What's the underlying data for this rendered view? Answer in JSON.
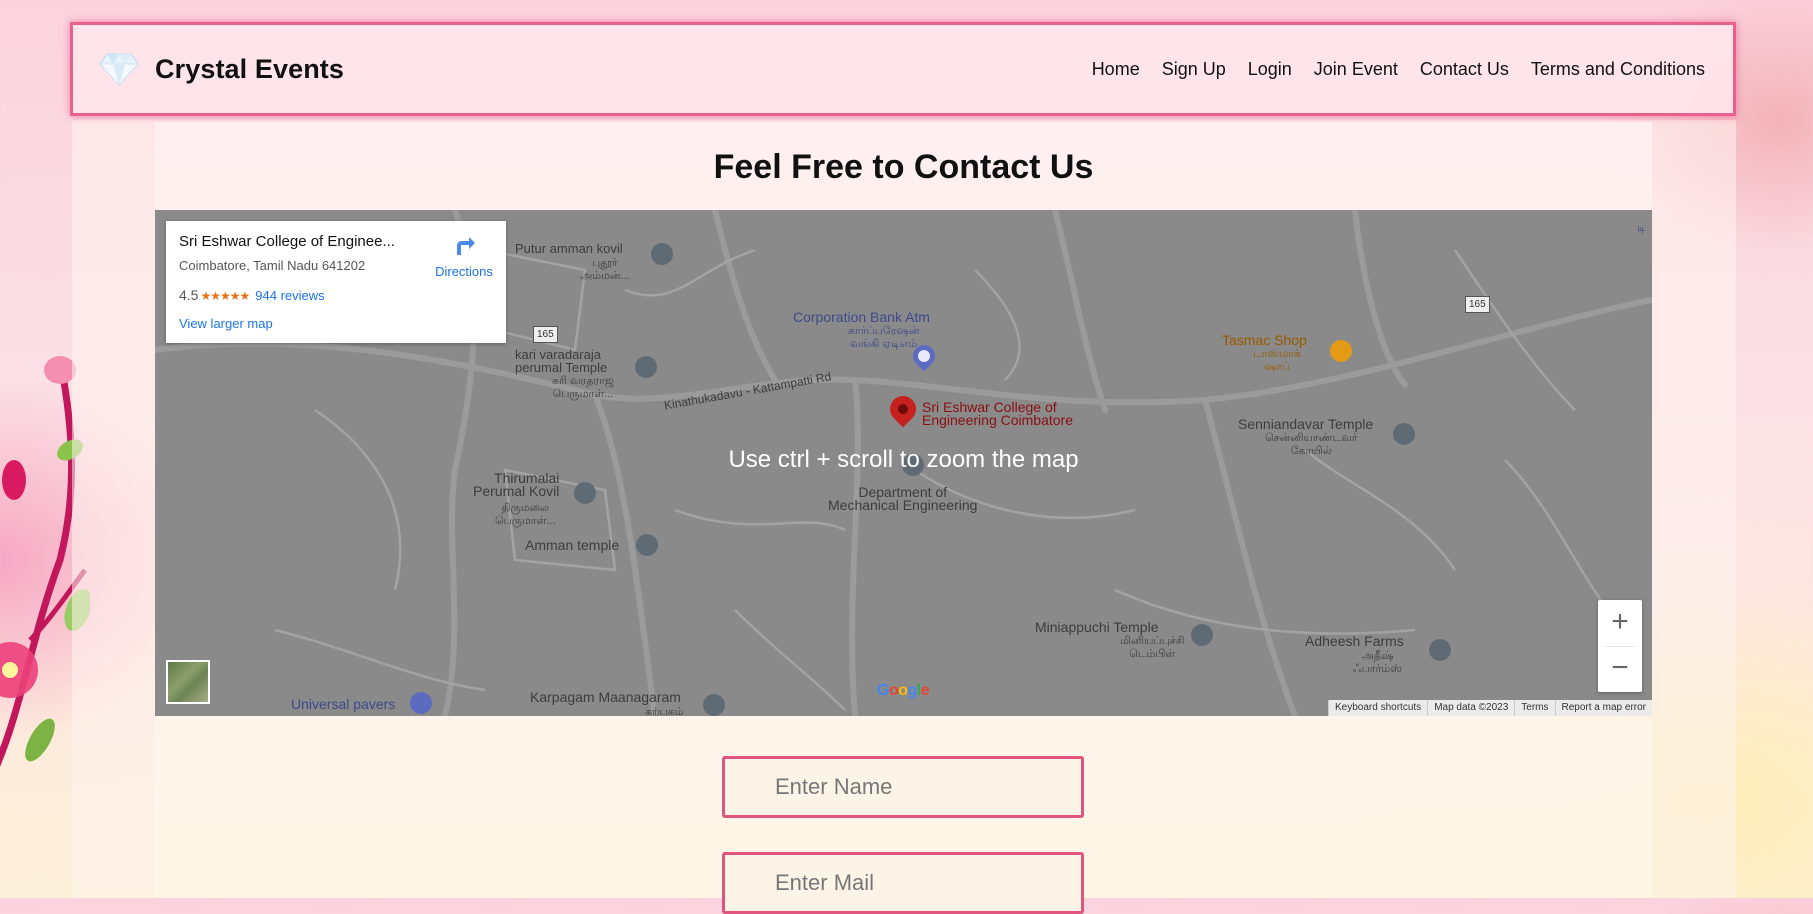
{
  "brand": {
    "name": "Crystal Events",
    "logo_icon": "diamond-icon"
  },
  "nav": {
    "links": [
      "Home",
      "Sign Up",
      "Login",
      "Join Event",
      "Contact Us",
      "Terms and Conditions"
    ]
  },
  "contact": {
    "heading": "Feel Free to Contact Us",
    "form": {
      "name_placeholder": "Enter Name",
      "mail_placeholder": "Enter Mail"
    }
  },
  "map": {
    "overlay_message": "Use ctrl + scroll to zoom the map",
    "place_card": {
      "title": "Sri Eshwar College of Enginee...",
      "address": "Coimbatore, Tamil Nadu 641202",
      "rating": "4.5",
      "stars": "★★★★★",
      "reviews": "944 reviews",
      "view_larger": "View larger map",
      "directions": "Directions"
    },
    "labels": {
      "putur_amman_kovil": "Putur amman kovil",
      "putur_tamil": "புதூர்\nஅம்மன்...",
      "route_165_a": "165",
      "route_165_b": "165",
      "corporation_bank": "Corporation Bank Atm",
      "corporation_bank_tamil": "கார்ப்பரேஷன்\nவங்கி ஏடிஎம்",
      "kari_varadaraja": "kari varadaraja\nperumal Temple",
      "kari_tamil": "கரி வரதராஜ\nபெருமாள்...",
      "road_name": "Kinathukadavu - Kattampatti Rd",
      "sri_eshwar_marker": "Sri Eshwar College of\nEngineering Coimbatore",
      "tasmac": "Tasmac Shop",
      "tasmac_tamil": "டாஸ்மாக்\nஷாப்",
      "senniandavar": "Senniandavar Temple",
      "senniandavar_tamil": "சென்னியாண்டவர்\nகோயில்",
      "thirumalai": "Thirumalai\nPerumal Kovil",
      "thirumalai_tamil": "திருமலை\nபெருமாள்...",
      "department": "Department of\nMechanical Engineering",
      "amman_temple": "Amman temple",
      "miniappuchi": "Miniappuchi Temple",
      "miniappuchi_tamil": "மினியப்புச்சி\nடெம்பிள்",
      "adheesh": "Adheesh Farms",
      "adheesh_tamil": "அதீஷ்\nஃபார்ம்ஸ்",
      "universal_pavers": "Universal pavers",
      "karpagam": "Karpagam Maanagaram",
      "karpagam_tamil": "கற்பகம்",
      "edge_text": "டி"
    },
    "zoom_in": "+",
    "zoom_out": "−",
    "google": "Google",
    "footer": {
      "shortcuts": "Keyboard shortcuts",
      "map_data": "Map data ©2023",
      "terms": "Terms",
      "report": "Report a map error"
    },
    "colors": {
      "pin_red": "#c5221f",
      "poi_grey": "#5f6b74",
      "poi_blue": "#5c6bc0",
      "poi_orange": "#e39b15"
    }
  },
  "theme": {
    "accent": "#e95f8e",
    "input_border": "#e0557f"
  }
}
